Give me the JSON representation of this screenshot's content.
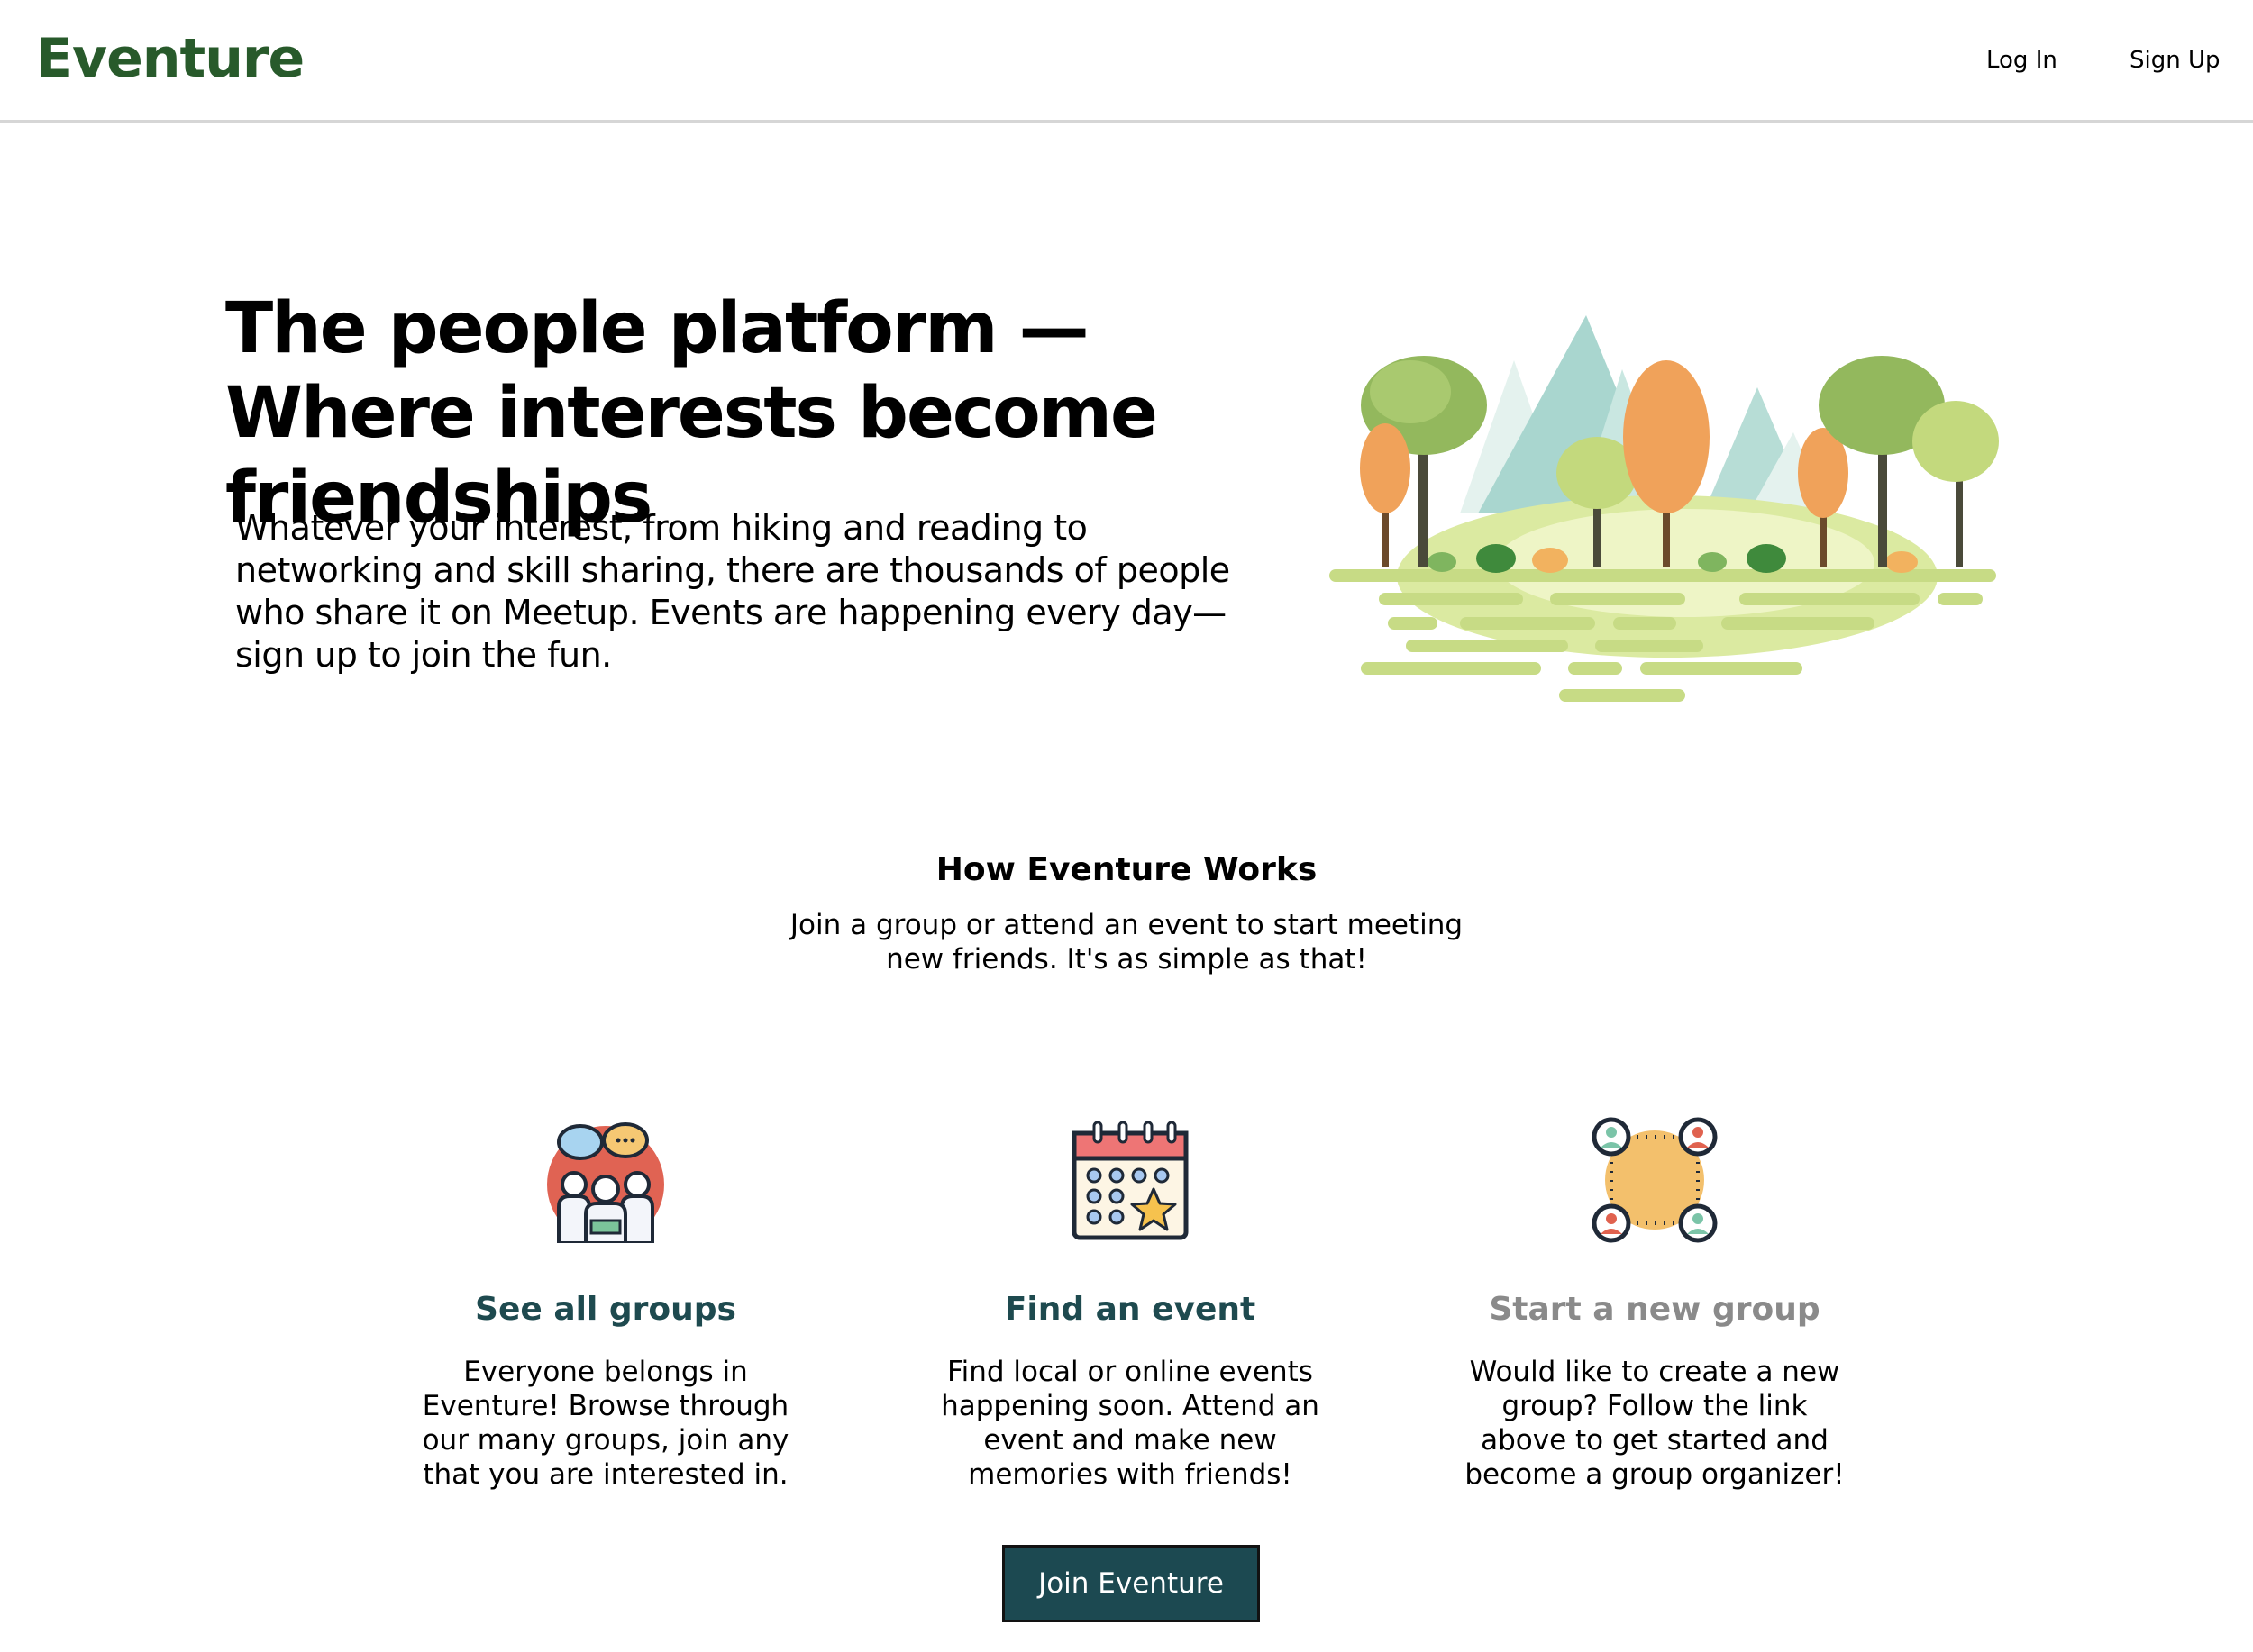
{
  "header": {
    "logo": "Eventure",
    "login_label": "Log In",
    "signup_label": "Sign Up"
  },
  "hero": {
    "title": "The people platform — Where interests become friendships",
    "subtitle": "Whatever your interest, from hiking and reading to networking and skill sharing, there are thousands of people who share it on Meetup. Events are happening every day—sign up to join the fun."
  },
  "how_it_works": {
    "title": "How Eventure Works",
    "subtitle": "Join a group or attend an event to start meeting new friends. It's as simple as that!"
  },
  "cards": [
    {
      "title": "See all groups",
      "text": "Everyone belongs in Eventure! Browse through our many groups, join any that you are interested in.",
      "icon": "group-chat-icon",
      "enabled": true
    },
    {
      "title": "Find an event",
      "text": "Find local or online events happening soon. Attend an event and make new memories with friends!",
      "icon": "calendar-icon",
      "enabled": true
    },
    {
      "title": "Start a new group",
      "text": "Would like to create a new group? Follow the link above to get started and become a group organizer!",
      "icon": "network-people-icon",
      "enabled": false
    }
  ],
  "cta": {
    "join_label": "Join Eventure"
  },
  "colors": {
    "brand": "#285a2b",
    "link": "#1e4a4f",
    "disabled_link": "#8a8a8a",
    "button_bg": "#1c4951"
  }
}
